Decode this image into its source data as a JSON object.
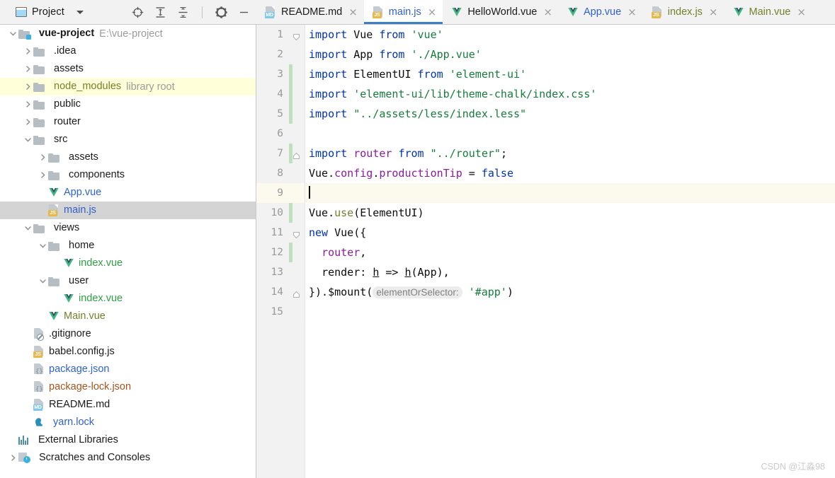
{
  "toolbar": {
    "window_icon": "project-window-icon",
    "title": "Project",
    "dropdown_caret": "chevron-down-icon",
    "buttons": [
      {
        "name": "locate-icon",
        "label": ""
      },
      {
        "name": "expand-all-icon",
        "label": ""
      },
      {
        "name": "collapse-all-icon",
        "label": ""
      },
      {
        "name": "settings-gear-icon",
        "label": ""
      },
      {
        "name": "hide-panel-icon",
        "label": ""
      }
    ]
  },
  "tabs": [
    {
      "label": "README.md",
      "icon": "md-file-icon",
      "color": "#1a1a1a",
      "active": false
    },
    {
      "label": "main.js",
      "icon": "js-file-icon",
      "color": "#2f5fd0",
      "active": true
    },
    {
      "label": "HelloWorld.vue",
      "icon": "vue-file-icon",
      "color": "#1a1a1a",
      "active": false
    },
    {
      "label": "App.vue",
      "icon": "vue-file-icon",
      "color": "#2f5fd0",
      "active": false
    },
    {
      "label": "index.js",
      "icon": "js-file-icon",
      "color": "#77802a",
      "active": false
    },
    {
      "label": "Main.vue",
      "icon": "vue-file-icon",
      "color": "#77802a",
      "active": false
    }
  ],
  "tab_close_glyph": "×",
  "tree": [
    {
      "label": "vue-project",
      "note": "E:\\vue-project",
      "indent": 0,
      "arrow": "down",
      "icon": "folder-module",
      "color": "#1a1a1a",
      "bold": true,
      "state": "normal"
    },
    {
      "label": ".idea",
      "note": "",
      "indent": 1,
      "arrow": "right",
      "icon": "folder",
      "color": "#1a1a1a",
      "bold": false,
      "state": "normal"
    },
    {
      "label": "assets",
      "note": "",
      "indent": 1,
      "arrow": "right",
      "icon": "folder",
      "color": "#1a1a1a",
      "bold": false,
      "state": "normal"
    },
    {
      "label": "node_modules",
      "note": "library root",
      "indent": 1,
      "arrow": "right",
      "icon": "folder",
      "color": "#77802a",
      "bold": false,
      "state": "highlight"
    },
    {
      "label": "public",
      "note": "",
      "indent": 1,
      "arrow": "right",
      "icon": "folder",
      "color": "#1a1a1a",
      "bold": false,
      "state": "normal"
    },
    {
      "label": "router",
      "note": "",
      "indent": 1,
      "arrow": "right",
      "icon": "folder",
      "color": "#1a1a1a",
      "bold": false,
      "state": "normal"
    },
    {
      "label": "src",
      "note": "",
      "indent": 1,
      "arrow": "down",
      "icon": "folder",
      "color": "#1a1a1a",
      "bold": false,
      "state": "normal"
    },
    {
      "label": "assets",
      "note": "",
      "indent": 2,
      "arrow": "right",
      "icon": "folder",
      "color": "#1a1a1a",
      "bold": false,
      "state": "normal"
    },
    {
      "label": "components",
      "note": "",
      "indent": 2,
      "arrow": "right",
      "icon": "folder",
      "color": "#1a1a1a",
      "bold": false,
      "state": "normal"
    },
    {
      "label": "App.vue",
      "note": "",
      "indent": 2,
      "arrow": "none",
      "icon": "vue",
      "color": "#2f5fd0",
      "bold": false,
      "state": "normal"
    },
    {
      "label": "main.js",
      "note": "",
      "indent": 2,
      "arrow": "none",
      "icon": "js",
      "color": "#2f5fd0",
      "bold": false,
      "state": "selected"
    },
    {
      "label": "views",
      "note": "",
      "indent": 1,
      "arrow": "down",
      "icon": "folder",
      "color": "#1a1a1a",
      "bold": false,
      "state": "normal"
    },
    {
      "label": "home",
      "note": "",
      "indent": 2,
      "arrow": "down",
      "icon": "folder",
      "color": "#1a1a1a",
      "bold": false,
      "state": "normal"
    },
    {
      "label": "index.vue",
      "note": "",
      "indent": 3,
      "arrow": "none",
      "icon": "vue",
      "color": "#2f9e44",
      "bold": false,
      "state": "normal"
    },
    {
      "label": "user",
      "note": "",
      "indent": 2,
      "arrow": "down",
      "icon": "folder",
      "color": "#1a1a1a",
      "bold": false,
      "state": "normal"
    },
    {
      "label": "index.vue",
      "note": "",
      "indent": 3,
      "arrow": "none",
      "icon": "vue",
      "color": "#2f9e44",
      "bold": false,
      "state": "normal"
    },
    {
      "label": "Main.vue",
      "note": "",
      "indent": 2,
      "arrow": "none",
      "icon": "vue",
      "color": "#77802a",
      "bold": false,
      "state": "normal"
    },
    {
      "label": ".gitignore",
      "note": "",
      "indent": 1,
      "arrow": "none",
      "icon": "gitignore",
      "color": "#1a1a1a",
      "bold": false,
      "state": "normal"
    },
    {
      "label": "babel.config.js",
      "note": "",
      "indent": 1,
      "arrow": "none",
      "icon": "js",
      "color": "#1a1a1a",
      "bold": false,
      "state": "normal"
    },
    {
      "label": "package.json",
      "note": "",
      "indent": 1,
      "arrow": "none",
      "icon": "json",
      "color": "#2f5fd0",
      "bold": false,
      "state": "normal"
    },
    {
      "label": "package-lock.json",
      "note": "",
      "indent": 1,
      "arrow": "none",
      "icon": "json",
      "color": "#a5541a",
      "bold": false,
      "state": "normal"
    },
    {
      "label": "README.md",
      "note": "",
      "indent": 1,
      "arrow": "none",
      "icon": "md",
      "color": "#1a1a1a",
      "bold": false,
      "state": "normal"
    },
    {
      "label": "yarn.lock",
      "note": "",
      "indent": 1,
      "arrow": "none",
      "icon": "yarn",
      "color": "#2f5fd0",
      "bold": false,
      "state": "normal"
    },
    {
      "label": "External Libraries",
      "note": "",
      "indent": 0,
      "arrow": "none",
      "icon": "library",
      "color": "#1a1a1a",
      "bold": false,
      "state": "normal"
    },
    {
      "label": "Scratches and Consoles",
      "note": "",
      "indent": 0,
      "arrow": "right",
      "icon": "scratch",
      "color": "#1a1a1a",
      "bold": false,
      "state": "normal"
    }
  ],
  "editor": {
    "filename": "main.js",
    "caret_line": 9,
    "total_lines": 15,
    "line_numbers": [
      "1",
      "2",
      "3",
      "4",
      "5",
      "6",
      "7",
      "8",
      "9",
      "10",
      "11",
      "12",
      "13",
      "14",
      "15"
    ],
    "lines": [
      {
        "n": 1,
        "fold": "open",
        "changed": false,
        "caret": false,
        "tokens": [
          {
            "t": "import",
            "c": "kw"
          },
          {
            "t": " ",
            "c": "ident"
          },
          {
            "t": "Vue",
            "c": "ident"
          },
          {
            "t": " ",
            "c": "ident"
          },
          {
            "t": "from",
            "c": "kw"
          },
          {
            "t": " ",
            "c": "ident"
          },
          {
            "t": "'vue'",
            "c": "str"
          }
        ]
      },
      {
        "n": 2,
        "fold": "",
        "changed": false,
        "caret": false,
        "tokens": [
          {
            "t": "import",
            "c": "kw"
          },
          {
            "t": " ",
            "c": "ident"
          },
          {
            "t": "App",
            "c": "ident"
          },
          {
            "t": " ",
            "c": "ident"
          },
          {
            "t": "from",
            "c": "kw"
          },
          {
            "t": " ",
            "c": "ident"
          },
          {
            "t": "'./App.vue'",
            "c": "str"
          }
        ]
      },
      {
        "n": 3,
        "fold": "",
        "changed": true,
        "caret": false,
        "tokens": [
          {
            "t": "import",
            "c": "kw"
          },
          {
            "t": " ",
            "c": "ident"
          },
          {
            "t": "ElementUI",
            "c": "ident"
          },
          {
            "t": " ",
            "c": "ident"
          },
          {
            "t": "from",
            "c": "kw"
          },
          {
            "t": " ",
            "c": "ident"
          },
          {
            "t": "'element-ui'",
            "c": "str"
          }
        ]
      },
      {
        "n": 4,
        "fold": "",
        "changed": true,
        "caret": false,
        "tokens": [
          {
            "t": "import",
            "c": "kw"
          },
          {
            "t": " ",
            "c": "ident"
          },
          {
            "t": "'element-ui/lib/theme-chalk/index.css'",
            "c": "str"
          }
        ]
      },
      {
        "n": 5,
        "fold": "",
        "changed": true,
        "caret": false,
        "tokens": [
          {
            "t": "import",
            "c": "kw"
          },
          {
            "t": " ",
            "c": "ident"
          },
          {
            "t": "\"../assets/less/index.less\"",
            "c": "str"
          }
        ]
      },
      {
        "n": 6,
        "fold": "",
        "changed": false,
        "caret": false,
        "tokens": []
      },
      {
        "n": 7,
        "fold": "close",
        "changed": true,
        "caret": false,
        "tokens": [
          {
            "t": "import",
            "c": "kw"
          },
          {
            "t": " ",
            "c": "ident"
          },
          {
            "t": "router",
            "c": "global"
          },
          {
            "t": " ",
            "c": "ident"
          },
          {
            "t": "from",
            "c": "kw"
          },
          {
            "t": " ",
            "c": "ident"
          },
          {
            "t": "\"../router\"",
            "c": "str"
          },
          {
            "t": ";",
            "c": "ident"
          }
        ]
      },
      {
        "n": 8,
        "fold": "",
        "changed": false,
        "caret": false,
        "tokens": [
          {
            "t": "Vue",
            "c": "ident"
          },
          {
            "t": ".",
            "c": "ident"
          },
          {
            "t": "config",
            "c": "prop"
          },
          {
            "t": ".",
            "c": "ident"
          },
          {
            "t": "productionTip",
            "c": "prop"
          },
          {
            "t": " = ",
            "c": "ident"
          },
          {
            "t": "false",
            "c": "kw"
          }
        ]
      },
      {
        "n": 9,
        "fold": "",
        "changed": false,
        "caret": true,
        "tokens": []
      },
      {
        "n": 10,
        "fold": "",
        "changed": true,
        "caret": false,
        "tokens": [
          {
            "t": "Vue",
            "c": "ident"
          },
          {
            "t": ".",
            "c": "ident"
          },
          {
            "t": "use",
            "c": "fn"
          },
          {
            "t": "(ElementUI)",
            "c": "ident"
          }
        ]
      },
      {
        "n": 11,
        "fold": "open",
        "changed": false,
        "caret": false,
        "tokens": [
          {
            "t": "new",
            "c": "kw"
          },
          {
            "t": " ",
            "c": "ident"
          },
          {
            "t": "Vue({",
            "c": "ident"
          }
        ]
      },
      {
        "n": 12,
        "fold": "",
        "changed": true,
        "caret": false,
        "tokens": [
          {
            "t": "  ",
            "c": "ident"
          },
          {
            "t": "router",
            "c": "global"
          },
          {
            "t": ",",
            "c": "ident"
          }
        ]
      },
      {
        "n": 13,
        "fold": "",
        "changed": false,
        "caret": false,
        "tokens": [
          {
            "t": "  ",
            "c": "ident"
          },
          {
            "t": "render",
            "c": "ident"
          },
          {
            "t": ": ",
            "c": "ident"
          },
          {
            "t": "h",
            "c": "lambda"
          },
          {
            "t": " => ",
            "c": "ident"
          },
          {
            "t": "h",
            "c": "lambda"
          },
          {
            "t": "(App),",
            "c": "ident"
          }
        ]
      },
      {
        "n": 14,
        "fold": "close",
        "changed": false,
        "caret": false,
        "tokens": [
          {
            "t": "}).$mount(",
            "c": "ident"
          },
          {
            "t": "elementOrSelector:",
            "c": "hint"
          },
          {
            "t": " ",
            "c": "ident"
          },
          {
            "t": "'#app'",
            "c": "str"
          },
          {
            "t": ")",
            "c": "ident"
          }
        ]
      },
      {
        "n": 15,
        "fold": "",
        "changed": false,
        "caret": false,
        "tokens": []
      }
    ]
  },
  "watermark": "CSDN @江淼98",
  "colors": {
    "accent": "#3b7fc4",
    "toolbar_bg": "#f2f2f2",
    "editor_bg": "#ffffff",
    "selection": "#d4d4d4",
    "highlight": "#ffffd9",
    "caret_line": "#fcfaef",
    "change_bar": "#bfe0bf"
  }
}
